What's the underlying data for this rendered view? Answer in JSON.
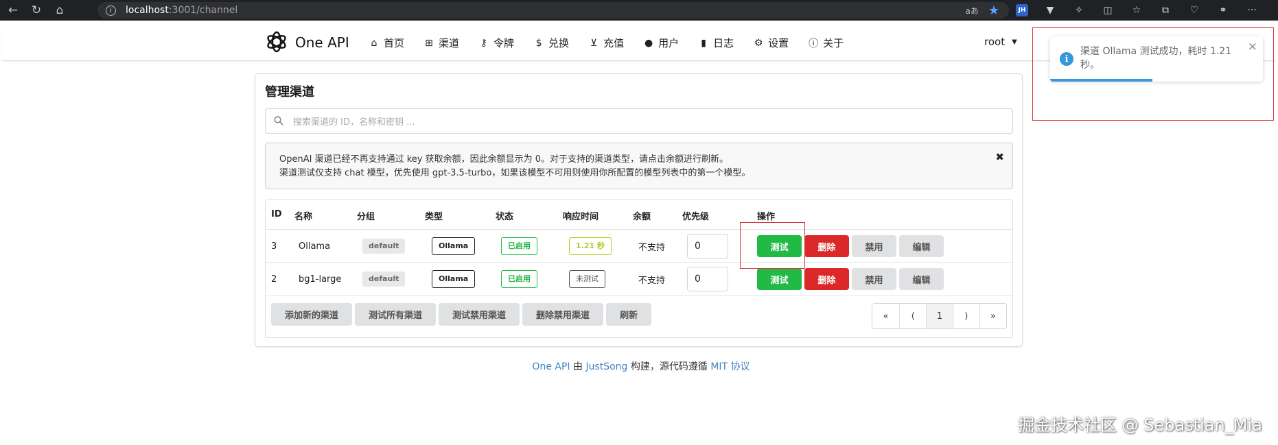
{
  "browser": {
    "url_host": "localhost",
    "url_path": ":3001/channel",
    "reader_label": "aあ"
  },
  "header": {
    "brand": "One API",
    "menu": [
      {
        "label": "首页",
        "icon": "home-icon"
      },
      {
        "label": "渠道",
        "icon": "sitemap-icon"
      },
      {
        "label": "令牌",
        "icon": "key-icon"
      },
      {
        "label": "兑换",
        "icon": "dollar-icon"
      },
      {
        "label": "充值",
        "icon": "cart-icon"
      },
      {
        "label": "用户",
        "icon": "user-icon"
      },
      {
        "label": "日志",
        "icon": "book-icon"
      },
      {
        "label": "设置",
        "icon": "gear-icon"
      },
      {
        "label": "关于",
        "icon": "info-icon"
      }
    ],
    "user": "root"
  },
  "toast": {
    "message": "渠道 Ollama 测试成功，耗时 1.21 秒。",
    "progress": 0.48,
    "color": "#3498db"
  },
  "page": {
    "title": "管理渠道",
    "search_placeholder": "搜索渠道的 ID，名称和密钥 ...",
    "notice_line1": "OpenAI 渠道已经不再支持通过 key 获取余额，因此余额显示为 0。对于支持的渠道类型，请点击余额进行刷新。",
    "notice_line2": "渠道测试仅支持 chat 模型，优先使用 gpt-3.5-turbo，如果该模型不可用则使用你所配置的模型列表中的第一个模型。"
  },
  "table": {
    "headers": [
      "ID",
      "名称",
      "分组",
      "类型",
      "状态",
      "响应时间",
      "余额",
      "优先级",
      "操作"
    ],
    "rows": [
      {
        "id": "3",
        "name": "Ollama",
        "group": "default",
        "type": "Ollama",
        "status": "已启用",
        "response": "1.21 秒",
        "balance": "不支持",
        "priority": "0"
      },
      {
        "id": "2",
        "name": "bg1-large",
        "group": "default",
        "type": "Ollama",
        "status": "已启用",
        "response": "未测试",
        "balance": "不支持",
        "priority": "0"
      }
    ],
    "actions": {
      "test": "测试",
      "delete": "删除",
      "disable": "禁用",
      "edit": "编辑"
    }
  },
  "footer_buttons": {
    "add": "添加新的渠道",
    "test_all": "测试所有渠道",
    "test_disabled": "测试禁用渠道",
    "delete_disabled": "删除禁用渠道",
    "refresh": "刷新"
  },
  "pager": {
    "first": "«",
    "prev": "⟨",
    "current": "1",
    "next": "⟩",
    "last": "»"
  },
  "page_footer": {
    "brand": "One API",
    "by": "由",
    "author": "JustSong",
    "middle": "构建，源代码遵循",
    "license": "MIT 协议"
  },
  "watermark": "掘金技术社区 @ Sebastian_Mia",
  "colors": {
    "green": "#21ba45",
    "red": "#db2828",
    "olive": "#b5cc18",
    "link": "#4183c4"
  }
}
